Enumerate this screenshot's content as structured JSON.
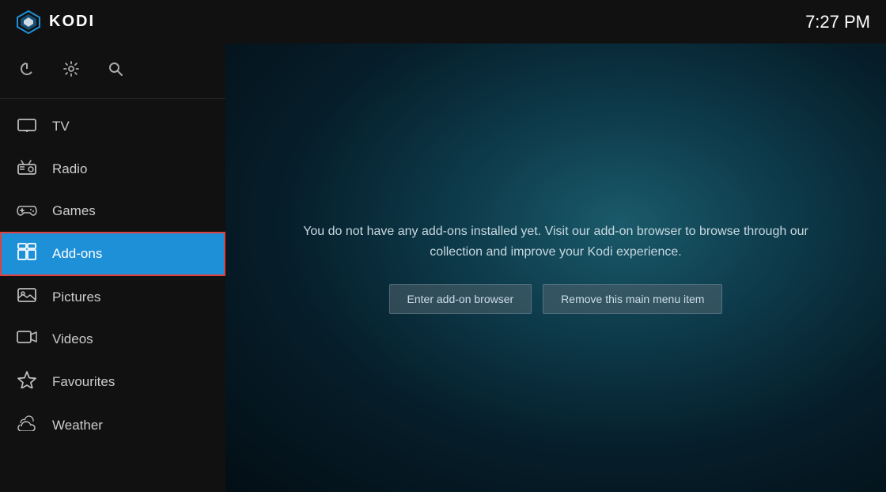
{
  "topbar": {
    "app_name": "KODI",
    "time": "7:27 PM"
  },
  "sidebar": {
    "icons": [
      {
        "name": "power-icon",
        "symbol": "⏻",
        "label": "Power"
      },
      {
        "name": "settings-icon",
        "symbol": "⚙",
        "label": "Settings"
      },
      {
        "name": "search-icon",
        "symbol": "🔍",
        "label": "Search"
      }
    ],
    "nav_items": [
      {
        "id": "tv",
        "label": "TV",
        "icon": "📺",
        "active": false
      },
      {
        "id": "radio",
        "label": "Radio",
        "icon": "📻",
        "active": false
      },
      {
        "id": "games",
        "label": "Games",
        "icon": "🎮",
        "active": false
      },
      {
        "id": "addons",
        "label": "Add-ons",
        "icon": "📦",
        "active": true
      },
      {
        "id": "pictures",
        "label": "Pictures",
        "icon": "🖼",
        "active": false
      },
      {
        "id": "videos",
        "label": "Videos",
        "icon": "🎞",
        "active": false
      },
      {
        "id": "favourites",
        "label": "Favourites",
        "icon": "⭐",
        "active": false
      },
      {
        "id": "weather",
        "label": "Weather",
        "icon": "🌥",
        "active": false
      }
    ]
  },
  "content": {
    "message": "You do not have any add-ons installed yet. Visit our add-on browser to browse through our collection and improve your Kodi experience.",
    "button_browser": "Enter add-on browser",
    "button_remove": "Remove this main menu item"
  }
}
